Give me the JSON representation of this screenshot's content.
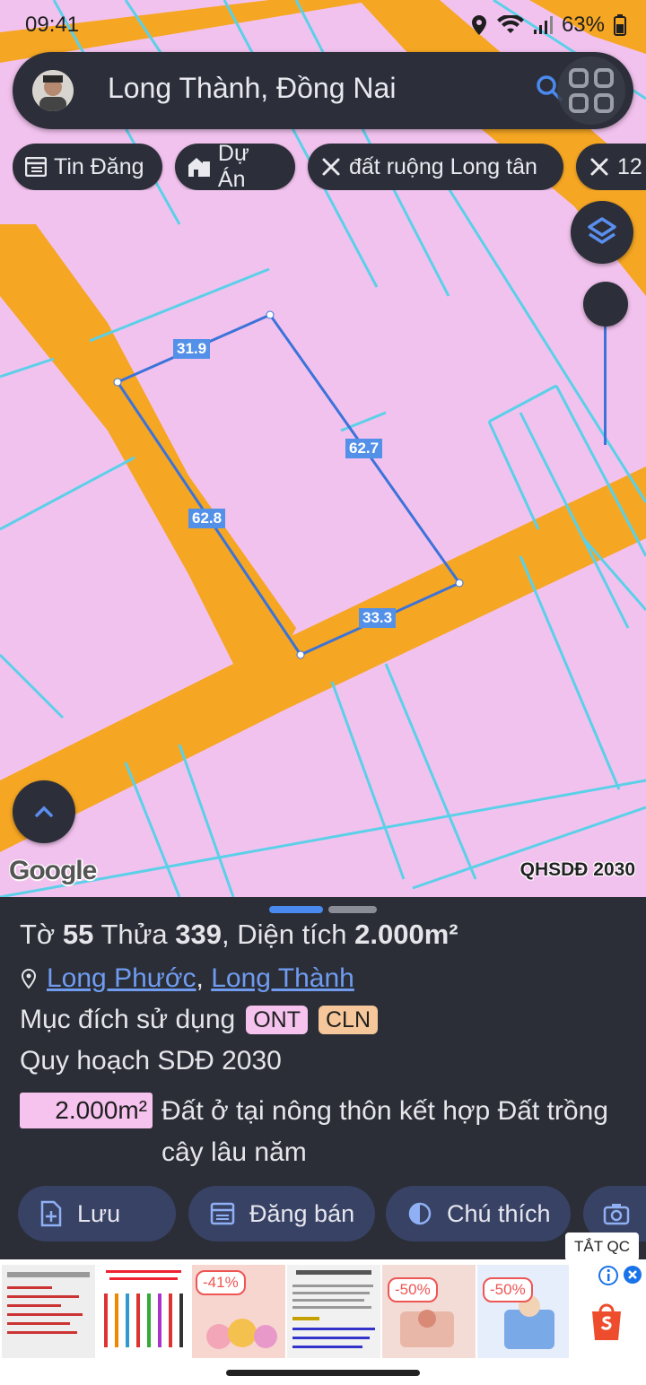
{
  "status_bar": {
    "time": "09:41",
    "battery": "63%"
  },
  "search": {
    "title": "Long Thành, Đồng Nai"
  },
  "chips": [
    {
      "label": "Tin Đăng",
      "icon": "listing-icon"
    },
    {
      "label": "Dự Án",
      "icon": "building-icon"
    },
    {
      "label": "đất ruộng Long tân",
      "icon": "tools-icon"
    },
    {
      "label": "12",
      "icon": "tools-icon"
    }
  ],
  "map": {
    "segment_labels": [
      "31.9",
      "62.7",
      "62.8",
      "33.3"
    ],
    "attribution": "Google",
    "layer_label": "QHSDĐ 2030"
  },
  "parcel": {
    "sheet_prefix": "Tờ",
    "sheet_number": "55",
    "lot_prefix": "Thửa",
    "lot_number": "339",
    "area_prefix": ", Diện tích",
    "area": "2.000m²",
    "ward": "Long Phước",
    "separator": ",",
    "district": "Long Thành",
    "purpose_label": "Mục đích sử dụng",
    "purpose_tags": [
      {
        "code": "ONT",
        "color": "#f6c2ee"
      },
      {
        "code": "CLN",
        "color": "#f6c79a"
      }
    ],
    "plan_label": "Quy hoạch SDĐ 2030",
    "plan_area": "2.000m²",
    "plan_description": "Đất ở tại nông thôn kết hợp Đất trồng cây lâu năm"
  },
  "actions": [
    {
      "label": "Lưu",
      "icon": "save-icon"
    },
    {
      "label": "Đăng bán",
      "icon": "post-icon"
    },
    {
      "label": "Chú thích",
      "icon": "legend-icon"
    },
    {
      "label": "",
      "icon": "camera-icon"
    }
  ],
  "ad": {
    "close_label": "TẮT QC",
    "discounts": [
      "-41%",
      "-50%",
      "-50%"
    ]
  },
  "colors": {
    "map_bg": "#f2c2ee",
    "road": "#f5a623",
    "boundary": "#5bd0e8",
    "parcel_outline": "#3b73d9",
    "panel": "#2b2e37",
    "link": "#6f9cf0"
  }
}
